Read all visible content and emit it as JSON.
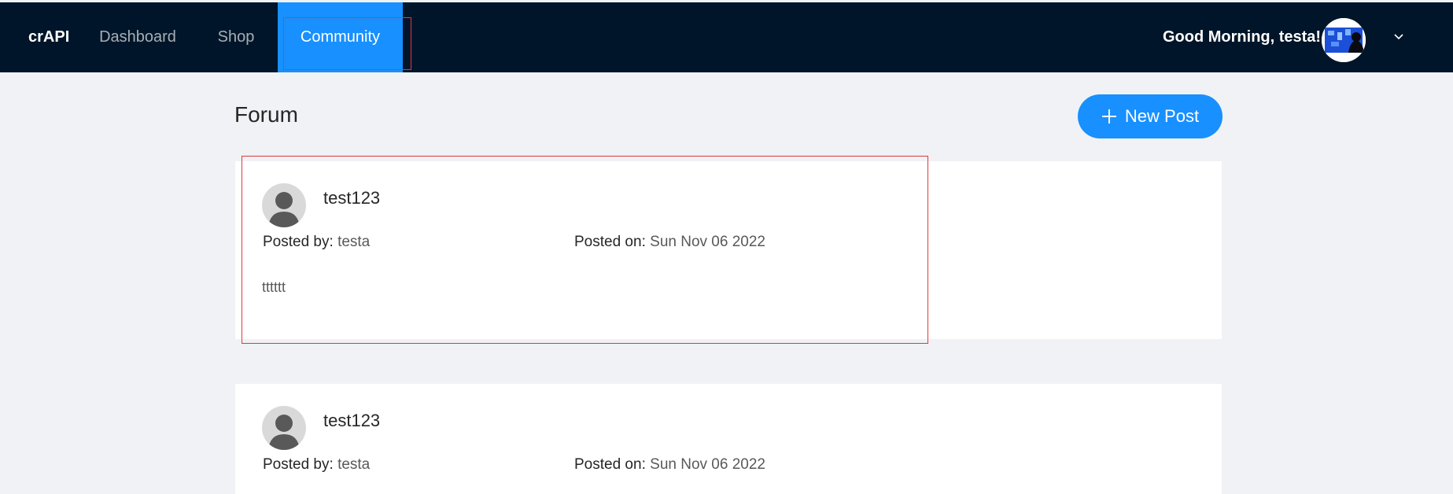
{
  "app": {
    "brand": "crAPI"
  },
  "nav": {
    "items": [
      {
        "label": "Dashboard"
      },
      {
        "label": "Shop"
      },
      {
        "label": "Community",
        "active": true
      }
    ]
  },
  "user": {
    "greeting": "Good Morning, testa!"
  },
  "forum": {
    "title": "Forum",
    "new_post_label": "New Post",
    "posts": [
      {
        "title": "test123",
        "posted_by_label": "Posted by",
        "posted_by": "testa",
        "posted_on_label": "Posted on",
        "posted_on": "Sun Nov 06 2022",
        "content": "tttttt"
      },
      {
        "title": "test123",
        "posted_by_label": "Posted by",
        "posted_by": "testa",
        "posted_on_label": "Posted on",
        "posted_on": "Sun Nov 06 2022"
      }
    ]
  },
  "colors": {
    "header_bg": "#001529",
    "accent": "#1890ff",
    "page_bg": "#f0f2f5",
    "highlight": "#e0393e"
  }
}
